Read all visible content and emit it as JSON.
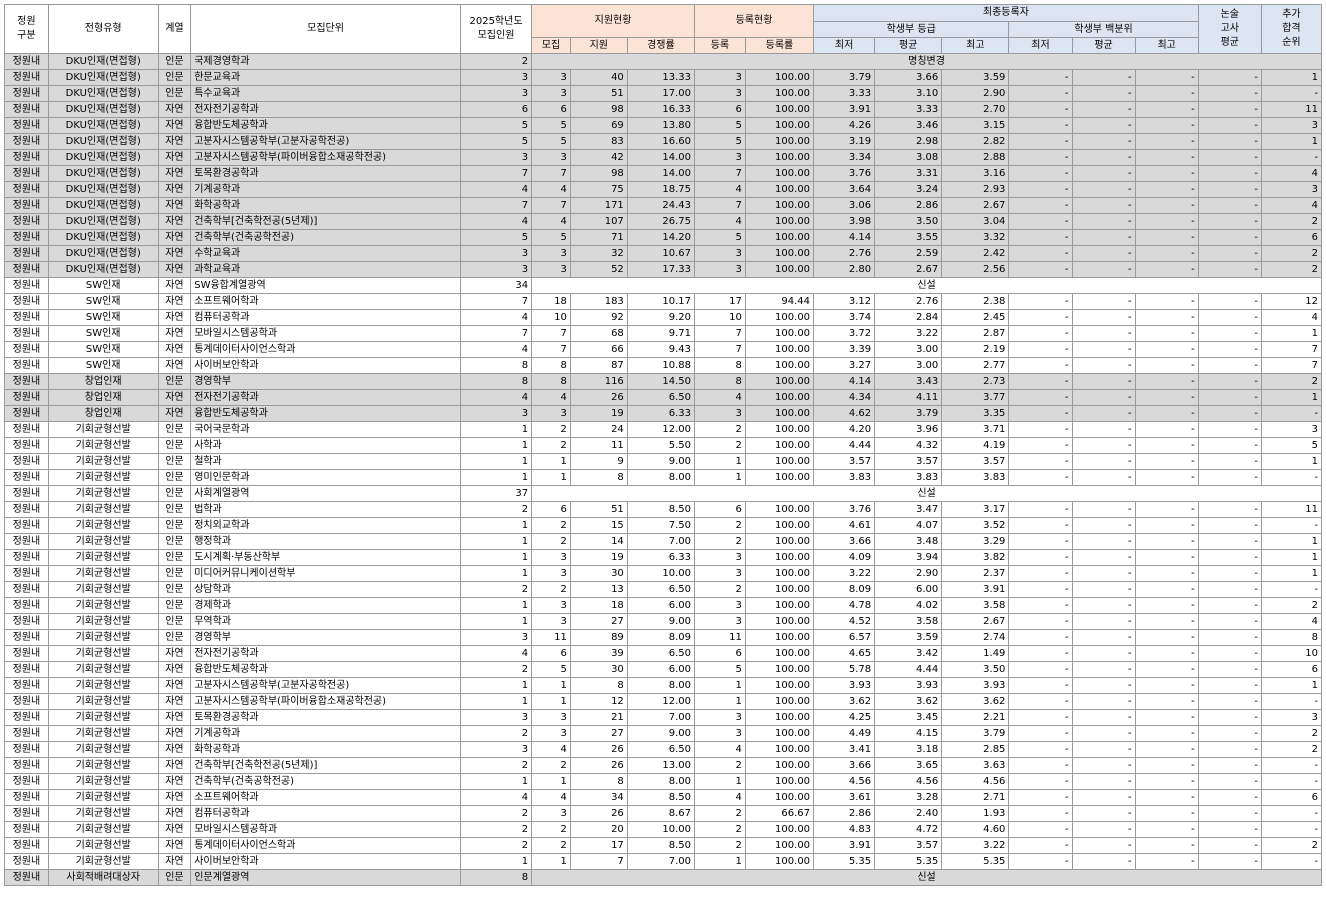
{
  "headers": {
    "division": "정원\n구분",
    "type": "전형유형",
    "track": "계열",
    "unit": "모집단위",
    "quota": "2025학년도\n모집인원",
    "apply_group": "지원현황",
    "reg_group": "등록현황",
    "final_group": "최종등록자",
    "grade_group": "학생부 등급",
    "pct_group": "학생부 백분위",
    "essay": "논술\n고사\n평균",
    "extra": "추가\n합격\n순위",
    "recruit": "모집",
    "apply": "지원",
    "ratio": "경쟁률",
    "reg": "등록",
    "reg_rate": "등록률",
    "min": "최저",
    "avg": "평균",
    "max": "최고"
  },
  "rows": [
    {
      "d": "정원내",
      "t": "DKU인재(면접형)",
      "k": "인문",
      "u": "국제경영학과",
      "q": "2",
      "note": "명칭변경",
      "gray": true
    },
    {
      "d": "정원내",
      "t": "DKU인재(면접형)",
      "k": "인문",
      "u": "한문교육과",
      "q": "3",
      "m": "3",
      "a": "40",
      "r": "13.33",
      "e": "3",
      "er": "100.00",
      "g1": "3.79",
      "g2": "3.66",
      "g3": "3.59",
      "p1": "-",
      "p2": "-",
      "p3": "-",
      "es": "-",
      "x": "1",
      "gray": true
    },
    {
      "d": "정원내",
      "t": "DKU인재(면접형)",
      "k": "인문",
      "u": "특수교육과",
      "q": "3",
      "m": "3",
      "a": "51",
      "r": "17.00",
      "e": "3",
      "er": "100.00",
      "g1": "3.33",
      "g2": "3.10",
      "g3": "2.90",
      "p1": "-",
      "p2": "-",
      "p3": "-",
      "es": "-",
      "x": "-",
      "gray": true
    },
    {
      "d": "정원내",
      "t": "DKU인재(면접형)",
      "k": "자연",
      "u": "전자전기공학과",
      "q": "6",
      "m": "6",
      "a": "98",
      "r": "16.33",
      "e": "6",
      "er": "100.00",
      "g1": "3.91",
      "g2": "3.33",
      "g3": "2.70",
      "p1": "-",
      "p2": "-",
      "p3": "-",
      "es": "-",
      "x": "11",
      "gray": true
    },
    {
      "d": "정원내",
      "t": "DKU인재(면접형)",
      "k": "자연",
      "u": "융합반도체공학과",
      "q": "5",
      "m": "5",
      "a": "69",
      "r": "13.80",
      "e": "5",
      "er": "100.00",
      "g1": "4.26",
      "g2": "3.46",
      "g3": "3.15",
      "p1": "-",
      "p2": "-",
      "p3": "-",
      "es": "-",
      "x": "3",
      "gray": true
    },
    {
      "d": "정원내",
      "t": "DKU인재(면접형)",
      "k": "자연",
      "u": "고분자시스템공학부(고분자공학전공)",
      "q": "5",
      "m": "5",
      "a": "83",
      "r": "16.60",
      "e": "5",
      "er": "100.00",
      "g1": "3.19",
      "g2": "2.98",
      "g3": "2.82",
      "p1": "-",
      "p2": "-",
      "p3": "-",
      "es": "-",
      "x": "1",
      "gray": true
    },
    {
      "d": "정원내",
      "t": "DKU인재(면접형)",
      "k": "자연",
      "u": "고분자시스템공학부(파이버융합소재공학전공)",
      "q": "3",
      "m": "3",
      "a": "42",
      "r": "14.00",
      "e": "3",
      "er": "100.00",
      "g1": "3.34",
      "g2": "3.08",
      "g3": "2.88",
      "p1": "-",
      "p2": "-",
      "p3": "-",
      "es": "-",
      "x": "-",
      "gray": true
    },
    {
      "d": "정원내",
      "t": "DKU인재(면접형)",
      "k": "자연",
      "u": "토목환경공학과",
      "q": "7",
      "m": "7",
      "a": "98",
      "r": "14.00",
      "e": "7",
      "er": "100.00",
      "g1": "3.76",
      "g2": "3.31",
      "g3": "3.16",
      "p1": "-",
      "p2": "-",
      "p3": "-",
      "es": "-",
      "x": "4",
      "gray": true
    },
    {
      "d": "정원내",
      "t": "DKU인재(면접형)",
      "k": "자연",
      "u": "기계공학과",
      "q": "4",
      "m": "4",
      "a": "75",
      "r": "18.75",
      "e": "4",
      "er": "100.00",
      "g1": "3.64",
      "g2": "3.24",
      "g3": "2.93",
      "p1": "-",
      "p2": "-",
      "p3": "-",
      "es": "-",
      "x": "3",
      "gray": true
    },
    {
      "d": "정원내",
      "t": "DKU인재(면접형)",
      "k": "자연",
      "u": "화학공학과",
      "q": "7",
      "m": "7",
      "a": "171",
      "r": "24.43",
      "e": "7",
      "er": "100.00",
      "g1": "3.06",
      "g2": "2.86",
      "g3": "2.67",
      "p1": "-",
      "p2": "-",
      "p3": "-",
      "es": "-",
      "x": "4",
      "gray": true
    },
    {
      "d": "정원내",
      "t": "DKU인재(면접형)",
      "k": "자연",
      "u": "건축학부[건축학전공(5년제)]",
      "q": "4",
      "m": "4",
      "a": "107",
      "r": "26.75",
      "e": "4",
      "er": "100.00",
      "g1": "3.98",
      "g2": "3.50",
      "g3": "3.04",
      "p1": "-",
      "p2": "-",
      "p3": "-",
      "es": "-",
      "x": "2",
      "gray": true
    },
    {
      "d": "정원내",
      "t": "DKU인재(면접형)",
      "k": "자연",
      "u": "건축학부(건축공학전공)",
      "q": "5",
      "m": "5",
      "a": "71",
      "r": "14.20",
      "e": "5",
      "er": "100.00",
      "g1": "4.14",
      "g2": "3.55",
      "g3": "3.32",
      "p1": "-",
      "p2": "-",
      "p3": "-",
      "es": "-",
      "x": "6",
      "gray": true
    },
    {
      "d": "정원내",
      "t": "DKU인재(면접형)",
      "k": "자연",
      "u": "수학교육과",
      "q": "3",
      "m": "3",
      "a": "32",
      "r": "10.67",
      "e": "3",
      "er": "100.00",
      "g1": "2.76",
      "g2": "2.59",
      "g3": "2.42",
      "p1": "-",
      "p2": "-",
      "p3": "-",
      "es": "-",
      "x": "2",
      "gray": true
    },
    {
      "d": "정원내",
      "t": "DKU인재(면접형)",
      "k": "자연",
      "u": "과학교육과",
      "q": "3",
      "m": "3",
      "a": "52",
      "r": "17.33",
      "e": "3",
      "er": "100.00",
      "g1": "2.80",
      "g2": "2.67",
      "g3": "2.56",
      "p1": "-",
      "p2": "-",
      "p3": "-",
      "es": "-",
      "x": "2",
      "gray": true
    },
    {
      "d": "정원내",
      "t": "SW인재",
      "k": "자연",
      "u": "SW융합계열광역",
      "q": "34",
      "note": "신설",
      "gray": false
    },
    {
      "d": "정원내",
      "t": "SW인재",
      "k": "자연",
      "u": "소프트웨어학과",
      "q": "7",
      "m": "18",
      "a": "183",
      "r": "10.17",
      "e": "17",
      "er": "94.44",
      "g1": "3.12",
      "g2": "2.76",
      "g3": "2.38",
      "p1": "-",
      "p2": "-",
      "p3": "-",
      "es": "-",
      "x": "12",
      "gray": false
    },
    {
      "d": "정원내",
      "t": "SW인재",
      "k": "자연",
      "u": "컴퓨터공학과",
      "q": "4",
      "m": "10",
      "a": "92",
      "r": "9.20",
      "e": "10",
      "er": "100.00",
      "g1": "3.74",
      "g2": "2.84",
      "g3": "2.45",
      "p1": "-",
      "p2": "-",
      "p3": "-",
      "es": "-",
      "x": "4",
      "gray": false
    },
    {
      "d": "정원내",
      "t": "SW인재",
      "k": "자연",
      "u": "모바일시스템공학과",
      "q": "7",
      "m": "7",
      "a": "68",
      "r": "9.71",
      "e": "7",
      "er": "100.00",
      "g1": "3.72",
      "g2": "3.22",
      "g3": "2.87",
      "p1": "-",
      "p2": "-",
      "p3": "-",
      "es": "-",
      "x": "1",
      "gray": false
    },
    {
      "d": "정원내",
      "t": "SW인재",
      "k": "자연",
      "u": "통계데이터사이언스학과",
      "q": "4",
      "m": "7",
      "a": "66",
      "r": "9.43",
      "e": "7",
      "er": "100.00",
      "g1": "3.39",
      "g2": "3.00",
      "g3": "2.19",
      "p1": "-",
      "p2": "-",
      "p3": "-",
      "es": "-",
      "x": "7",
      "gray": false
    },
    {
      "d": "정원내",
      "t": "SW인재",
      "k": "자연",
      "u": "사이버보안학과",
      "q": "8",
      "m": "8",
      "a": "87",
      "r": "10.88",
      "e": "8",
      "er": "100.00",
      "g1": "3.27",
      "g2": "3.00",
      "g3": "2.77",
      "p1": "-",
      "p2": "-",
      "p3": "-",
      "es": "-",
      "x": "7",
      "gray": false
    },
    {
      "d": "정원내",
      "t": "창업인재",
      "k": "인문",
      "u": "경영학부",
      "q": "8",
      "m": "8",
      "a": "116",
      "r": "14.50",
      "e": "8",
      "er": "100.00",
      "g1": "4.14",
      "g2": "3.43",
      "g3": "2.73",
      "p1": "-",
      "p2": "-",
      "p3": "-",
      "es": "-",
      "x": "2",
      "gray": true
    },
    {
      "d": "정원내",
      "t": "창업인재",
      "k": "자연",
      "u": "전자전기공학과",
      "q": "4",
      "m": "4",
      "a": "26",
      "r": "6.50",
      "e": "4",
      "er": "100.00",
      "g1": "4.34",
      "g2": "4.11",
      "g3": "3.77",
      "p1": "-",
      "p2": "-",
      "p3": "-",
      "es": "-",
      "x": "1",
      "gray": true
    },
    {
      "d": "정원내",
      "t": "창업인재",
      "k": "자연",
      "u": "융합반도체공학과",
      "q": "3",
      "m": "3",
      "a": "19",
      "r": "6.33",
      "e": "3",
      "er": "100.00",
      "g1": "4.62",
      "g2": "3.79",
      "g3": "3.35",
      "p1": "-",
      "p2": "-",
      "p3": "-",
      "es": "-",
      "x": "-",
      "gray": true
    },
    {
      "d": "정원내",
      "t": "기회균형선발",
      "k": "인문",
      "u": "국어국문학과",
      "q": "1",
      "m": "2",
      "a": "24",
      "r": "12.00",
      "e": "2",
      "er": "100.00",
      "g1": "4.20",
      "g2": "3.96",
      "g3": "3.71",
      "p1": "-",
      "p2": "-",
      "p3": "-",
      "es": "-",
      "x": "3",
      "gray": false
    },
    {
      "d": "정원내",
      "t": "기회균형선발",
      "k": "인문",
      "u": "사학과",
      "q": "1",
      "m": "2",
      "a": "11",
      "r": "5.50",
      "e": "2",
      "er": "100.00",
      "g1": "4.44",
      "g2": "4.32",
      "g3": "4.19",
      "p1": "-",
      "p2": "-",
      "p3": "-",
      "es": "-",
      "x": "5",
      "gray": false
    },
    {
      "d": "정원내",
      "t": "기회균형선발",
      "k": "인문",
      "u": "철학과",
      "q": "1",
      "m": "1",
      "a": "9",
      "r": "9.00",
      "e": "1",
      "er": "100.00",
      "g1": "3.57",
      "g2": "3.57",
      "g3": "3.57",
      "p1": "-",
      "p2": "-",
      "p3": "-",
      "es": "-",
      "x": "1",
      "gray": false
    },
    {
      "d": "정원내",
      "t": "기회균형선발",
      "k": "인문",
      "u": "영미인문학과",
      "q": "1",
      "m": "1",
      "a": "8",
      "r": "8.00",
      "e": "1",
      "er": "100.00",
      "g1": "3.83",
      "g2": "3.83",
      "g3": "3.83",
      "p1": "-",
      "p2": "-",
      "p3": "-",
      "es": "-",
      "x": "-",
      "gray": false
    },
    {
      "d": "정원내",
      "t": "기회균형선발",
      "k": "인문",
      "u": "사회계열광역",
      "q": "37",
      "note": "신설",
      "gray": false
    },
    {
      "d": "정원내",
      "t": "기회균형선발",
      "k": "인문",
      "u": "법학과",
      "q": "2",
      "m": "6",
      "a": "51",
      "r": "8.50",
      "e": "6",
      "er": "100.00",
      "g1": "3.76",
      "g2": "3.47",
      "g3": "3.17",
      "p1": "-",
      "p2": "-",
      "p3": "-",
      "es": "-",
      "x": "11",
      "gray": false
    },
    {
      "d": "정원내",
      "t": "기회균형선발",
      "k": "인문",
      "u": "정치외교학과",
      "q": "1",
      "m": "2",
      "a": "15",
      "r": "7.50",
      "e": "2",
      "er": "100.00",
      "g1": "4.61",
      "g2": "4.07",
      "g3": "3.52",
      "p1": "-",
      "p2": "-",
      "p3": "-",
      "es": "-",
      "x": "-",
      "gray": false
    },
    {
      "d": "정원내",
      "t": "기회균형선발",
      "k": "인문",
      "u": "행정학과",
      "q": "1",
      "m": "2",
      "a": "14",
      "r": "7.00",
      "e": "2",
      "er": "100.00",
      "g1": "3.66",
      "g2": "3.48",
      "g3": "3.29",
      "p1": "-",
      "p2": "-",
      "p3": "-",
      "es": "-",
      "x": "1",
      "gray": false
    },
    {
      "d": "정원내",
      "t": "기회균형선발",
      "k": "인문",
      "u": "도시계획·부동산학부",
      "q": "1",
      "m": "3",
      "a": "19",
      "r": "6.33",
      "e": "3",
      "er": "100.00",
      "g1": "4.09",
      "g2": "3.94",
      "g3": "3.82",
      "p1": "-",
      "p2": "-",
      "p3": "-",
      "es": "-",
      "x": "1",
      "gray": false
    },
    {
      "d": "정원내",
      "t": "기회균형선발",
      "k": "인문",
      "u": "미디어커뮤니케이션학부",
      "q": "1",
      "m": "3",
      "a": "30",
      "r": "10.00",
      "e": "3",
      "er": "100.00",
      "g1": "3.22",
      "g2": "2.90",
      "g3": "2.37",
      "p1": "-",
      "p2": "-",
      "p3": "-",
      "es": "-",
      "x": "1",
      "gray": false
    },
    {
      "d": "정원내",
      "t": "기회균형선발",
      "k": "인문",
      "u": "상담학과",
      "q": "2",
      "m": "2",
      "a": "13",
      "r": "6.50",
      "e": "2",
      "er": "100.00",
      "g1": "8.09",
      "g2": "6.00",
      "g3": "3.91",
      "p1": "-",
      "p2": "-",
      "p3": "-",
      "es": "-",
      "x": "-",
      "gray": false
    },
    {
      "d": "정원내",
      "t": "기회균형선발",
      "k": "인문",
      "u": "경제학과",
      "q": "1",
      "m": "3",
      "a": "18",
      "r": "6.00",
      "e": "3",
      "er": "100.00",
      "g1": "4.78",
      "g2": "4.02",
      "g3": "3.58",
      "p1": "-",
      "p2": "-",
      "p3": "-",
      "es": "-",
      "x": "2",
      "gray": false
    },
    {
      "d": "정원내",
      "t": "기회균형선발",
      "k": "인문",
      "u": "무역학과",
      "q": "1",
      "m": "3",
      "a": "27",
      "r": "9.00",
      "e": "3",
      "er": "100.00",
      "g1": "4.52",
      "g2": "3.58",
      "g3": "2.67",
      "p1": "-",
      "p2": "-",
      "p3": "-",
      "es": "-",
      "x": "4",
      "gray": false
    },
    {
      "d": "정원내",
      "t": "기회균형선발",
      "k": "인문",
      "u": "경영학부",
      "q": "3",
      "m": "11",
      "a": "89",
      "r": "8.09",
      "e": "11",
      "er": "100.00",
      "g1": "6.57",
      "g2": "3.59",
      "g3": "2.74",
      "p1": "-",
      "p2": "-",
      "p3": "-",
      "es": "-",
      "x": "8",
      "gray": false
    },
    {
      "d": "정원내",
      "t": "기회균형선발",
      "k": "자연",
      "u": "전자전기공학과",
      "q": "4",
      "m": "6",
      "a": "39",
      "r": "6.50",
      "e": "6",
      "er": "100.00",
      "g1": "4.65",
      "g2": "3.42",
      "g3": "1.49",
      "p1": "-",
      "p2": "-",
      "p3": "-",
      "es": "-",
      "x": "10",
      "gray": false
    },
    {
      "d": "정원내",
      "t": "기회균형선발",
      "k": "자연",
      "u": "융합반도체공학과",
      "q": "2",
      "m": "5",
      "a": "30",
      "r": "6.00",
      "e": "5",
      "er": "100.00",
      "g1": "5.78",
      "g2": "4.44",
      "g3": "3.50",
      "p1": "-",
      "p2": "-",
      "p3": "-",
      "es": "-",
      "x": "6",
      "gray": false
    },
    {
      "d": "정원내",
      "t": "기회균형선발",
      "k": "자연",
      "u": "고분자시스템공학부(고분자공학전공)",
      "q": "1",
      "m": "1",
      "a": "8",
      "r": "8.00",
      "e": "1",
      "er": "100.00",
      "g1": "3.93",
      "g2": "3.93",
      "g3": "3.93",
      "p1": "-",
      "p2": "-",
      "p3": "-",
      "es": "-",
      "x": "1",
      "gray": false
    },
    {
      "d": "정원내",
      "t": "기회균형선발",
      "k": "자연",
      "u": "고분자시스템공학부(파이버융합소재공학전공)",
      "q": "1",
      "m": "1",
      "a": "12",
      "r": "12.00",
      "e": "1",
      "er": "100.00",
      "g1": "3.62",
      "g2": "3.62",
      "g3": "3.62",
      "p1": "-",
      "p2": "-",
      "p3": "-",
      "es": "-",
      "x": "-",
      "gray": false
    },
    {
      "d": "정원내",
      "t": "기회균형선발",
      "k": "자연",
      "u": "토목환경공학과",
      "q": "3",
      "m": "3",
      "a": "21",
      "r": "7.00",
      "e": "3",
      "er": "100.00",
      "g1": "4.25",
      "g2": "3.45",
      "g3": "2.21",
      "p1": "-",
      "p2": "-",
      "p3": "-",
      "es": "-",
      "x": "3",
      "gray": false
    },
    {
      "d": "정원내",
      "t": "기회균형선발",
      "k": "자연",
      "u": "기계공학과",
      "q": "2",
      "m": "3",
      "a": "27",
      "r": "9.00",
      "e": "3",
      "er": "100.00",
      "g1": "4.49",
      "g2": "4.15",
      "g3": "3.79",
      "p1": "-",
      "p2": "-",
      "p3": "-",
      "es": "-",
      "x": "2",
      "gray": false
    },
    {
      "d": "정원내",
      "t": "기회균형선발",
      "k": "자연",
      "u": "화학공학과",
      "q": "3",
      "m": "4",
      "a": "26",
      "r": "6.50",
      "e": "4",
      "er": "100.00",
      "g1": "3.41",
      "g2": "3.18",
      "g3": "2.85",
      "p1": "-",
      "p2": "-",
      "p3": "-",
      "es": "-",
      "x": "2",
      "gray": false
    },
    {
      "d": "정원내",
      "t": "기회균형선발",
      "k": "자연",
      "u": "건축학부[건축학전공(5년제)]",
      "q": "2",
      "m": "2",
      "a": "26",
      "r": "13.00",
      "e": "2",
      "er": "100.00",
      "g1": "3.66",
      "g2": "3.65",
      "g3": "3.63",
      "p1": "-",
      "p2": "-",
      "p3": "-",
      "es": "-",
      "x": "-",
      "gray": false
    },
    {
      "d": "정원내",
      "t": "기회균형선발",
      "k": "자연",
      "u": "건축학부(건축공학전공)",
      "q": "1",
      "m": "1",
      "a": "8",
      "r": "8.00",
      "e": "1",
      "er": "100.00",
      "g1": "4.56",
      "g2": "4.56",
      "g3": "4.56",
      "p1": "-",
      "p2": "-",
      "p3": "-",
      "es": "-",
      "x": "-",
      "gray": false
    },
    {
      "d": "정원내",
      "t": "기회균형선발",
      "k": "자연",
      "u": "소프트웨어학과",
      "q": "4",
      "m": "4",
      "a": "34",
      "r": "8.50",
      "e": "4",
      "er": "100.00",
      "g1": "3.61",
      "g2": "3.28",
      "g3": "2.71",
      "p1": "-",
      "p2": "-",
      "p3": "-",
      "es": "-",
      "x": "6",
      "gray": false
    },
    {
      "d": "정원내",
      "t": "기회균형선발",
      "k": "자연",
      "u": "컴퓨터공학과",
      "q": "2",
      "m": "3",
      "a": "26",
      "r": "8.67",
      "e": "2",
      "er": "66.67",
      "g1": "2.86",
      "g2": "2.40",
      "g3": "1.93",
      "p1": "-",
      "p2": "-",
      "p3": "-",
      "es": "-",
      "x": "-",
      "gray": false
    },
    {
      "d": "정원내",
      "t": "기회균형선발",
      "k": "자연",
      "u": "모바일시스템공학과",
      "q": "2",
      "m": "2",
      "a": "20",
      "r": "10.00",
      "e": "2",
      "er": "100.00",
      "g1": "4.83",
      "g2": "4.72",
      "g3": "4.60",
      "p1": "-",
      "p2": "-",
      "p3": "-",
      "es": "-",
      "x": "-",
      "gray": false
    },
    {
      "d": "정원내",
      "t": "기회균형선발",
      "k": "자연",
      "u": "통계데이터사이언스학과",
      "q": "2",
      "m": "2",
      "a": "17",
      "r": "8.50",
      "e": "2",
      "er": "100.00",
      "g1": "3.91",
      "g2": "3.57",
      "g3": "3.22",
      "p1": "-",
      "p2": "-",
      "p3": "-",
      "es": "-",
      "x": "2",
      "gray": false
    },
    {
      "d": "정원내",
      "t": "기회균형선발",
      "k": "자연",
      "u": "사이버보안학과",
      "q": "1",
      "m": "1",
      "a": "7",
      "r": "7.00",
      "e": "1",
      "er": "100.00",
      "g1": "5.35",
      "g2": "5.35",
      "g3": "5.35",
      "p1": "-",
      "p2": "-",
      "p3": "-",
      "es": "-",
      "x": "-",
      "gray": false
    },
    {
      "d": "정원내",
      "t": "사회적배려대상자",
      "k": "인문",
      "u": "인문계열광역",
      "q": "8",
      "note": "신설",
      "gray": true
    }
  ]
}
